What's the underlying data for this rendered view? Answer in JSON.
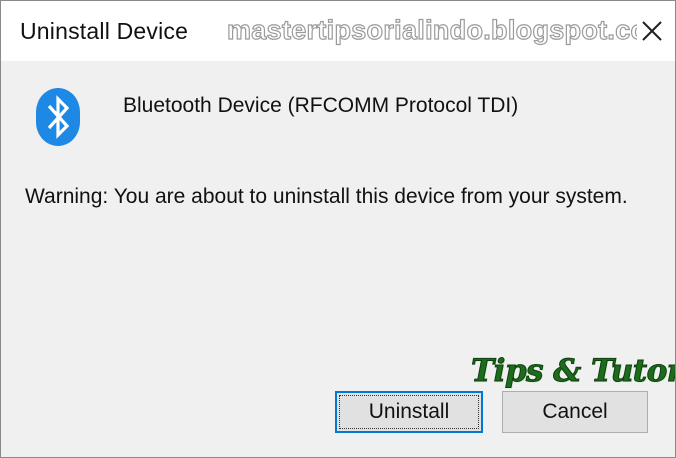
{
  "dialog": {
    "title": "Uninstall Device",
    "device_name": "Bluetooth Device (RFCOMM Protocol TDI)",
    "warning": "Warning: You are about to uninstall this device from your system.",
    "icon": "bluetooth-icon",
    "close_icon": "close-icon"
  },
  "buttons": {
    "uninstall_label": "Uninstall",
    "cancel_label": "Cancel"
  },
  "watermarks": {
    "site": "mastertipsorialindo.blogspot.com",
    "badge": "Tips & Tutorial"
  },
  "colors": {
    "bluetooth_blue": "#1e88e5",
    "accent_focus": "#0078d7",
    "dialog_background": "#f0f0f0",
    "title_bar": "#ffffff"
  }
}
